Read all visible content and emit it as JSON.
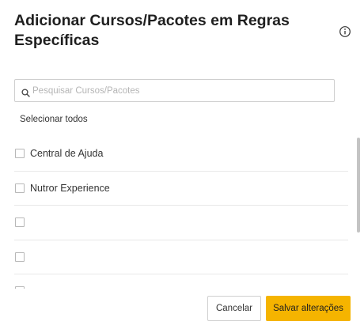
{
  "modal": {
    "title": "Adicionar Cursos/Pacotes em Regras Específicas",
    "info_icon": "info-circle-icon"
  },
  "search": {
    "placeholder": "Pesquisar Cursos/Pacotes",
    "value": "",
    "icon": "search-icon"
  },
  "select_all_label": "Selecionar todos",
  "list": {
    "items": [
      {
        "label": "Central de Ajuda",
        "checked": false
      },
      {
        "label": "Nutror Experience",
        "checked": false
      },
      {
        "label": "",
        "checked": false
      },
      {
        "label": "",
        "checked": false
      },
      {
        "label": "",
        "checked": false
      }
    ]
  },
  "footer": {
    "cancel_label": "Cancelar",
    "save_label": "Salvar alterações"
  },
  "colors": {
    "primary": "#f5b400",
    "border": "#cfcfcf",
    "divider": "#e8e8e8",
    "text": "#1f1f1f"
  }
}
